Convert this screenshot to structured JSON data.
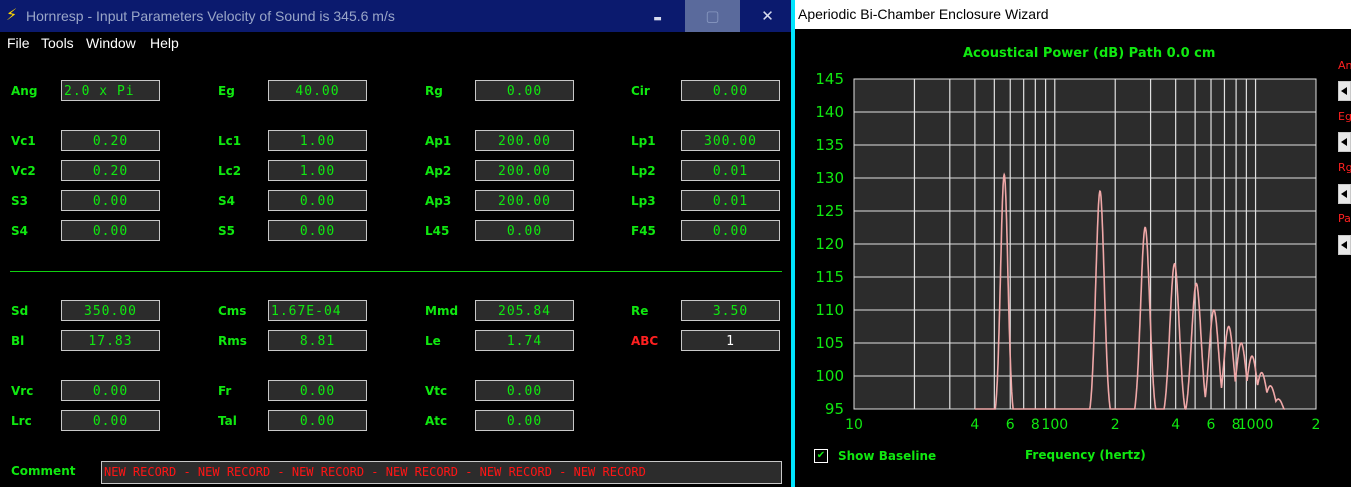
{
  "left_window": {
    "title": "Hornresp - Input Parameters   Velocity of Sound is 345.6 m/s",
    "minimize_glyph": "▬",
    "maximize_glyph": "▢",
    "close_glyph": "✕",
    "menu": [
      "File",
      "Tools",
      "Window",
      "Help"
    ],
    "fields": [
      {
        "label": "Ang",
        "value": "2.0 x Pi"
      },
      {
        "label": "Eg",
        "value": "40.00"
      },
      {
        "label": "Rg",
        "value": "0.00"
      },
      {
        "label": "Cir",
        "value": "0.00"
      },
      {
        "label": "Vc1",
        "value": "0.20"
      },
      {
        "label": "Lc1",
        "value": "1.00"
      },
      {
        "label": "Ap1",
        "value": "200.00"
      },
      {
        "label": "Lp1",
        "value": "300.00"
      },
      {
        "label": "Vc2",
        "value": "0.20"
      },
      {
        "label": "Lc2",
        "value": "1.00"
      },
      {
        "label": "Ap2",
        "value": "200.00"
      },
      {
        "label": "Lp2",
        "value": "0.01"
      },
      {
        "label": "S3",
        "value": "0.00"
      },
      {
        "label": "S4",
        "value": "0.00"
      },
      {
        "label": "Ap3",
        "value": "200.00"
      },
      {
        "label": "Lp3",
        "value": "0.01"
      },
      {
        "label": "S4",
        "value": "0.00"
      },
      {
        "label": "S5",
        "value": "0.00"
      },
      {
        "label": "L45",
        "value": "0.00"
      },
      {
        "label": "F45",
        "value": "0.00"
      },
      {
        "label": "Sd",
        "value": "350.00"
      },
      {
        "label": "Cms",
        "value": "1.67E-04"
      },
      {
        "label": "Mmd",
        "value": "205.84"
      },
      {
        "label": "Re",
        "value": "3.50"
      },
      {
        "label": "Bl",
        "value": "17.83"
      },
      {
        "label": "Rms",
        "value": "8.81"
      },
      {
        "label": "Le",
        "value": "1.74"
      },
      {
        "label": "ABC",
        "value": "1"
      },
      {
        "label": "Vrc",
        "value": "0.00"
      },
      {
        "label": "Fr",
        "value": "0.00"
      },
      {
        "label": "Vtc",
        "value": "0.00"
      },
      {
        "label": "Lrc",
        "value": "0.00"
      },
      {
        "label": "Tal",
        "value": "0.00"
      },
      {
        "label": "Atc",
        "value": "0.00"
      }
    ],
    "comment_label": "Comment",
    "comment_value": "NEW RECORD - NEW RECORD - NEW RECORD - NEW RECORD - NEW RECORD - NEW RECORD",
    "colors": {
      "label_green": "#10e810",
      "label_red": "#ff2020",
      "title_bar": "#0b1a6e"
    }
  },
  "right_window": {
    "title": "Aperiodic Bi-Chamber Enclosure Wizard",
    "side_labels": [
      "An",
      "Eg",
      "Rg",
      "Pa"
    ],
    "show_baseline_label": "Show Baseline",
    "show_baseline_checked": true,
    "chart_data": {
      "type": "line",
      "title": "Acoustical Power (dB)   Path 0.0 cm",
      "xlabel": "Frequency (hertz)",
      "ylabel": "",
      "x_scale": "log",
      "xlim": [
        10,
        2000
      ],
      "ylim": [
        95,
        145
      ],
      "y_ticks": [
        95,
        100,
        105,
        110,
        115,
        120,
        125,
        130,
        135,
        140,
        145
      ],
      "x_tick_labels": [
        {
          "x": 10,
          "label": "10"
        },
        {
          "x": 20,
          "label": ""
        },
        {
          "x": 40,
          "label": "4"
        },
        {
          "x": 60,
          "label": "6"
        },
        {
          "x": 80,
          "label": "8"
        },
        {
          "x": 100,
          "label": "100"
        },
        {
          "x": 200,
          "label": "2"
        },
        {
          "x": 400,
          "label": "4"
        },
        {
          "x": 600,
          "label": "6"
        },
        {
          "x": 800,
          "label": "8"
        },
        {
          "x": 1000,
          "label": "1000"
        },
        {
          "x": 2000,
          "label": "2"
        }
      ],
      "grid": true,
      "series": [
        {
          "color": "#f0a8a8",
          "peaks": [
            {
              "f": 56,
              "db": 130.5
            },
            {
              "f": 168,
              "db": 128
            },
            {
              "f": 282,
              "db": 122.5
            },
            {
              "f": 395,
              "db": 117
            },
            {
              "f": 507,
              "db": 114
            },
            {
              "f": 620,
              "db": 110
            },
            {
              "f": 735,
              "db": 107.5
            },
            {
              "f": 848,
              "db": 105
            },
            {
              "f": 960,
              "db": 103
            },
            {
              "f": 1072,
              "db": 100.5
            },
            {
              "f": 1185,
              "db": 98.5
            },
            {
              "f": 1298,
              "db": 96.5
            }
          ]
        }
      ]
    },
    "colors": {
      "plot_bg": "#2c2c2c",
      "grid": "#e0e0e0",
      "accent": "#00e5ff",
      "text": "#10e810"
    }
  }
}
